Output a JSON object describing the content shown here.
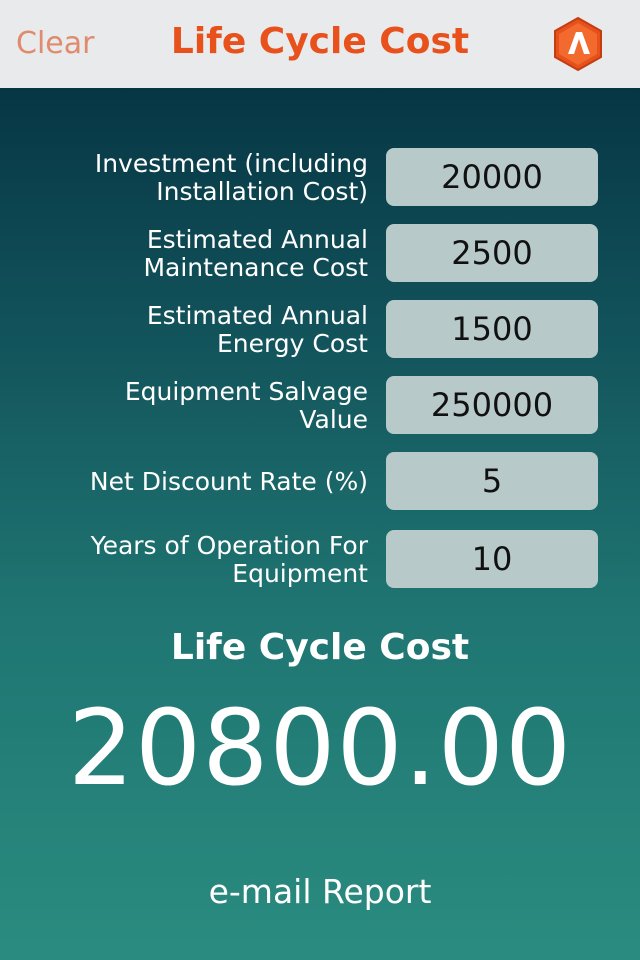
{
  "header": {
    "clear_label": "Clear",
    "title": "Life Cycle Cost",
    "logo_icon": "app-logo-icon",
    "title_color": "#e8501c",
    "clear_color": "#e08a6e"
  },
  "form": {
    "rows": [
      {
        "label": "Investment (including\nInstallation Cost)",
        "value": "20000"
      },
      {
        "label": "Estimated Annual\nMaintenance Cost",
        "value": "2500"
      },
      {
        "label": "Estimated Annual\nEnergy Cost",
        "value": "1500"
      },
      {
        "label": "Equipment Salvage\nValue",
        "value": "250000"
      },
      {
        "label": "Net Discount Rate (%)",
        "value": "5"
      },
      {
        "label": "Years of Operation For\nEquipment",
        "value": "10"
      }
    ]
  },
  "result": {
    "title": "Life Cycle Cost",
    "value": "20800.00"
  },
  "footer": {
    "email_label": "e-mail Report"
  }
}
